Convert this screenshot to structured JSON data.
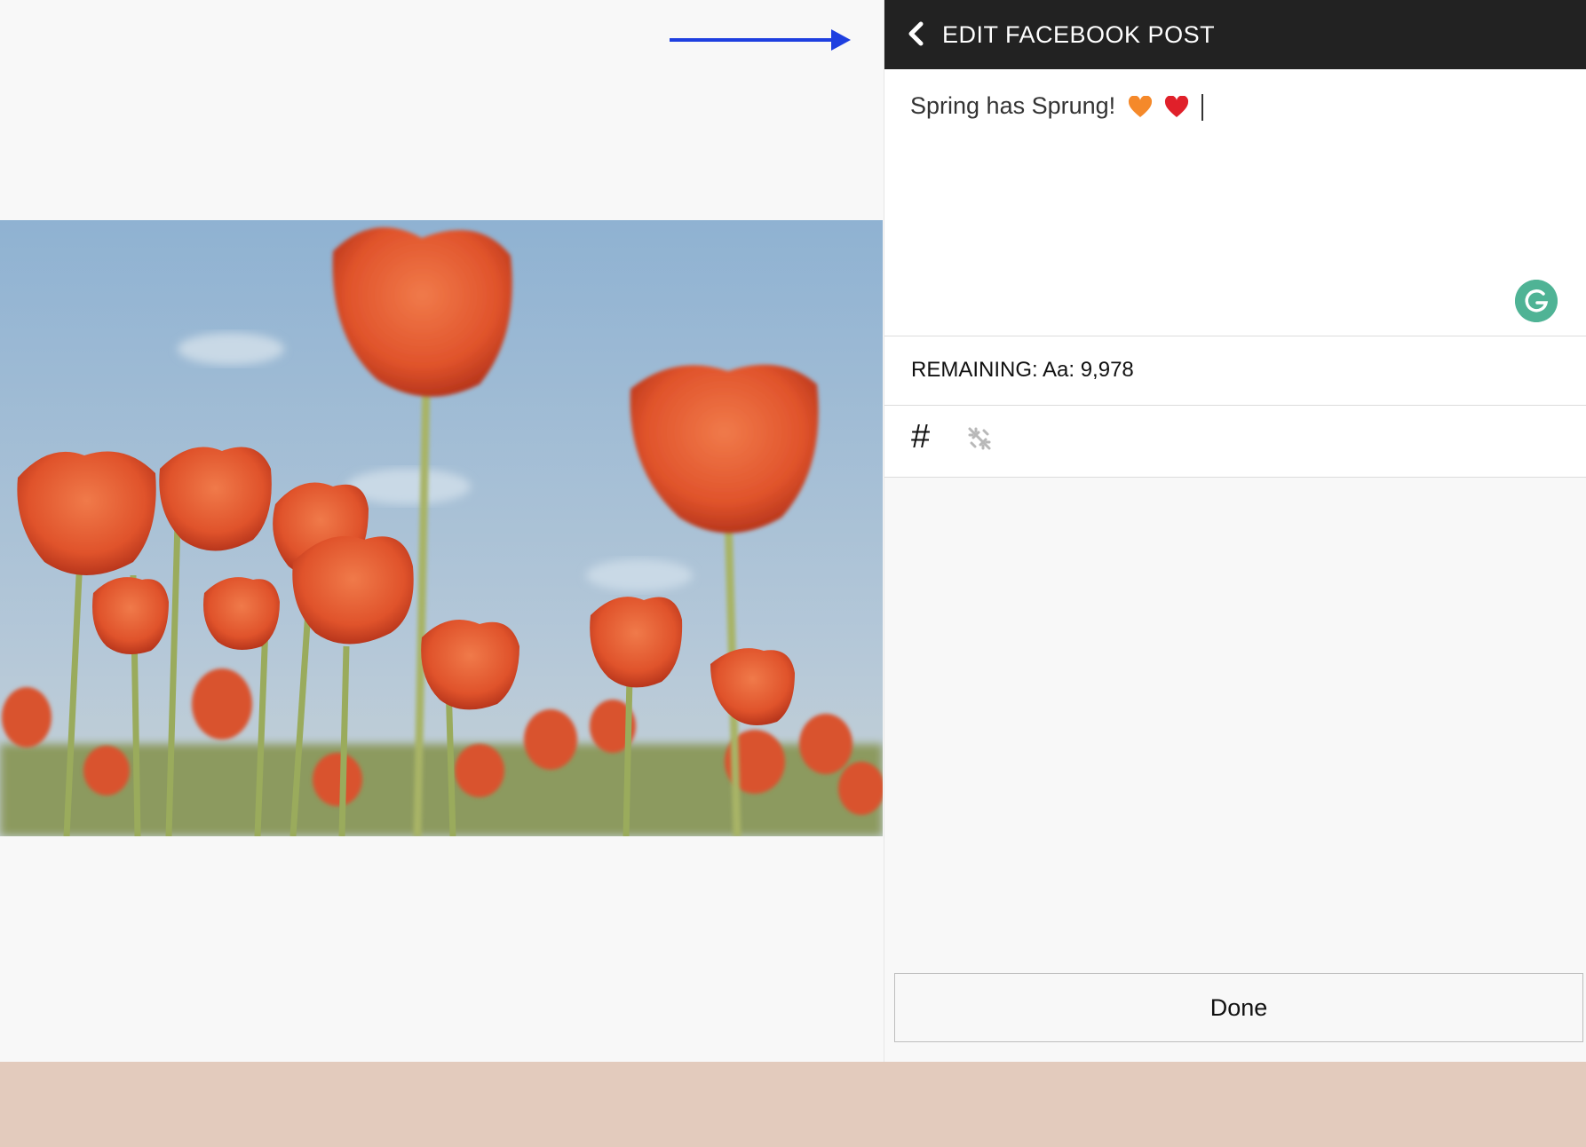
{
  "header": {
    "title": "EDIT FACEBOOK POST",
    "back_icon": "chevron-left-icon"
  },
  "editor": {
    "text": "Spring has Sprung!",
    "emojis": [
      "orange-heart",
      "red-heart"
    ],
    "grammarly_icon": "grammarly-icon"
  },
  "counter": {
    "label": "REMAINING: Aa: 9,978"
  },
  "tools": {
    "hashtag": "#",
    "unlink_icon": "unlink-icon"
  },
  "done_button": "Done",
  "colors": {
    "header_bg": "#222222",
    "arrow": "#1e3fe0",
    "grammarly": "#4fb395",
    "footer": "#e3cbbd",
    "orange_heart": "#f5892a",
    "red_heart": "#e0202a"
  }
}
